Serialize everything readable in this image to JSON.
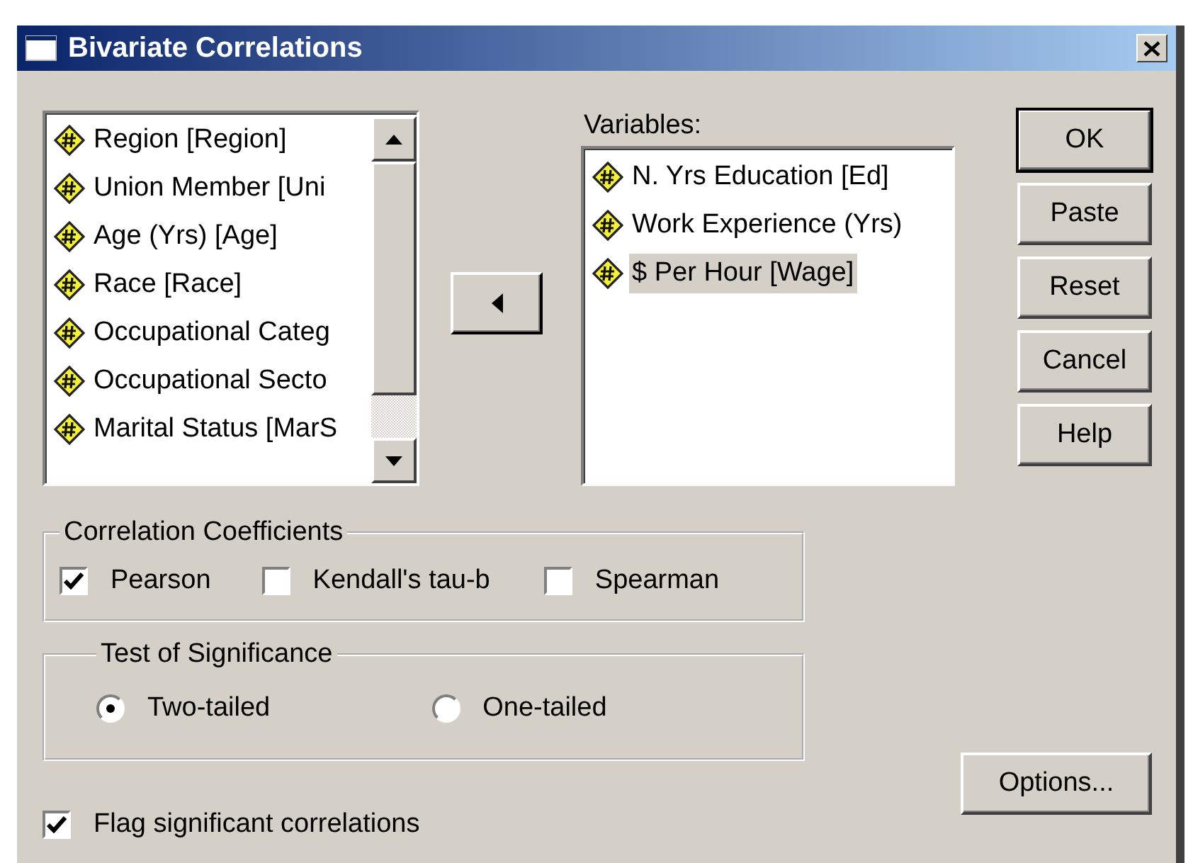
{
  "window": {
    "title": "Bivariate Correlations"
  },
  "source_list": {
    "items": [
      {
        "label": "Region [Region]",
        "selected": false
      },
      {
        "label": "Union Member [Uni",
        "selected": false
      },
      {
        "label": "Age (Yrs) [Age]",
        "selected": false
      },
      {
        "label": "Race [Race]",
        "selected": false
      },
      {
        "label": "Occupational Categ",
        "selected": false
      },
      {
        "label": "Occupational Secto",
        "selected": false
      },
      {
        "label": "Marital Status [MarS",
        "selected": false
      }
    ]
  },
  "target_list": {
    "label": "Variables:",
    "items": [
      {
        "label": "N. Yrs Education [Ed]",
        "selected": false
      },
      {
        "label": "Work Experience (Yrs)",
        "selected": false
      },
      {
        "label": "$ Per Hour [Wage]",
        "selected": true
      }
    ]
  },
  "buttons": [
    {
      "label": "OK",
      "default": true
    },
    {
      "label": "Paste",
      "default": false
    },
    {
      "label": "Reset",
      "default": false
    },
    {
      "label": "Cancel",
      "default": false
    },
    {
      "label": "Help",
      "default": false
    }
  ],
  "coefficients": {
    "title": "Correlation Coefficients",
    "options": [
      {
        "label": "Pearson",
        "checked": true
      },
      {
        "label": "Kendall's tau-b",
        "checked": false
      },
      {
        "label": "Spearman",
        "checked": false
      }
    ]
  },
  "significance": {
    "title": "Test of Significance",
    "options": [
      {
        "label": "Two-tailed",
        "selected": true
      },
      {
        "label": "One-tailed",
        "selected": false
      }
    ]
  },
  "flag": {
    "label": "Flag significant correlations",
    "checked": true
  },
  "options_button": {
    "label": "Options..."
  }
}
